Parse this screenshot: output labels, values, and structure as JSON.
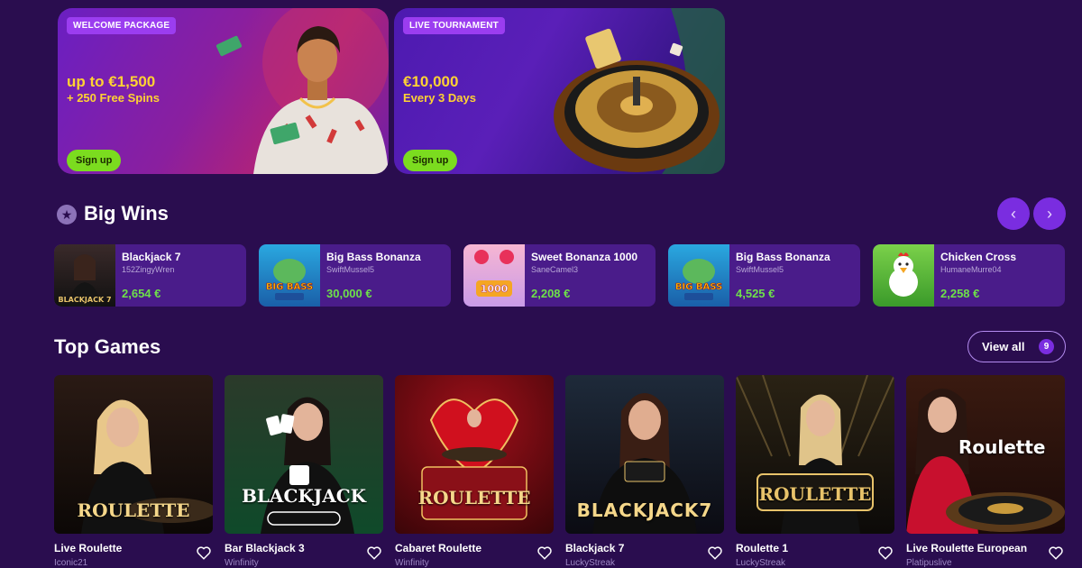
{
  "promos": [
    {
      "tag": "WELCOME PACKAGE",
      "amount": "up to €1,500",
      "sub": "+ 250 Free Spins",
      "button": "Sign up"
    },
    {
      "tag": "LIVE TOURNAMENT",
      "amount": "€10,000",
      "sub": "Every 3 Days",
      "button": "Sign up"
    }
  ],
  "big_wins": {
    "title": "Big Wins",
    "icon": "star-icon",
    "prev_icon": "chevron-left-icon",
    "next_icon": "chevron-right-icon",
    "items": [
      {
        "game": "Blackjack 7",
        "user": "152ZingyWren",
        "amount": "2,654 €",
        "thumb_text": "BLACKJACK 7"
      },
      {
        "game": "Big Bass Bonanza",
        "user": "SwiftMussel5",
        "amount": "30,000 €",
        "thumb_text": "BIG BASS"
      },
      {
        "game": "Sweet Bonanza 1000",
        "user": "SaneCamel3",
        "amount": "2,208 €",
        "thumb_text": "1000"
      },
      {
        "game": "Big Bass Bonanza",
        "user": "SwiftMussel5",
        "amount": "4,525 €",
        "thumb_text": "BIG BASS"
      },
      {
        "game": "Chicken Cross",
        "user": "HumaneMurre04",
        "amount": "2,258 €",
        "thumb_text": ""
      }
    ]
  },
  "top_games": {
    "title": "Top Games",
    "view_all": "View all",
    "view_all_count": "9",
    "items": [
      {
        "title": "Live Roulette",
        "provider": "Iconic21",
        "logo": "ROULETTE"
      },
      {
        "title": "Bar Blackjack 3",
        "provider": "Winfinity",
        "logo": "BLACKJACK"
      },
      {
        "title": "Cabaret Roulette",
        "provider": "Winfinity",
        "logo": "ROULETTE"
      },
      {
        "title": "Blackjack 7",
        "provider": "LuckyStreak",
        "logo": "BLACKJACK7"
      },
      {
        "title": "Roulette 1",
        "provider": "LuckyStreak",
        "logo": "ROULETTE"
      },
      {
        "title": "Live Roulette European",
        "provider": "Platipuslive",
        "logo": "Roulette"
      }
    ]
  },
  "colors": {
    "background": "#2a0d4f",
    "card": "#4a1c8a",
    "accent": "#7a2de0",
    "win_green": "#6ee04a",
    "button_green": "#7bdc1f",
    "promo_yellow": "#ffd233"
  }
}
